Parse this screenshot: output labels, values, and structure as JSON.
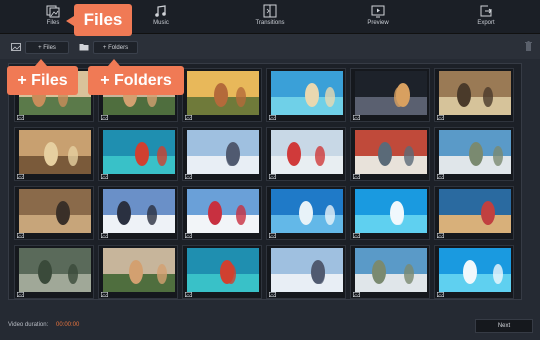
{
  "nav": [
    {
      "label": "Files",
      "icon": "files-icon"
    },
    {
      "label": "Music",
      "icon": "music-icon"
    },
    {
      "label": "Transitions",
      "icon": "transitions-icon"
    },
    {
      "label": "Preview",
      "icon": "preview-icon"
    },
    {
      "label": "Export",
      "icon": "export-icon"
    }
  ],
  "toolbar": {
    "add_files": "+ Files",
    "add_folders": "+ Folders"
  },
  "callouts": {
    "files_tab": "Files",
    "add_files": "+ Files",
    "add_folders": "+ Folders"
  },
  "tiles": [
    {
      "name": "group-of-friends-photo"
    },
    {
      "name": "friends-walking-photo"
    },
    {
      "name": "sunset-crowd-photo"
    },
    {
      "name": "beach-jump-photo"
    },
    {
      "name": "couple-cheering-photo"
    },
    {
      "name": "desert-travel-photo"
    },
    {
      "name": "mountain-biker-photo"
    },
    {
      "name": "kayak-photo"
    },
    {
      "name": "ski-friends-photo"
    },
    {
      "name": "paraglider-photo"
    },
    {
      "name": "running-track-photo"
    },
    {
      "name": "skateboarder-photo"
    },
    {
      "name": "motorbike-jump-photo"
    },
    {
      "name": "skier-photo"
    },
    {
      "name": "snowboarder-photo"
    },
    {
      "name": "surfer-photo"
    },
    {
      "name": "swimmer-photo"
    },
    {
      "name": "runners-photo"
    },
    {
      "name": "cyclists-photo"
    },
    {
      "name": "friends-walking-photo-2"
    },
    {
      "name": "kayak-photo-2"
    },
    {
      "name": "ski-friends-photo-2"
    },
    {
      "name": "skateboarder-photo-2"
    },
    {
      "name": "swimmer-photo-2"
    }
  ],
  "footer": {
    "duration_label": "Video duration:",
    "duration_value": "00:00:00",
    "next_label": "Next"
  },
  "colors": {
    "accent": "#f07a55",
    "duration": "#e8743f",
    "background": "#252a33"
  }
}
